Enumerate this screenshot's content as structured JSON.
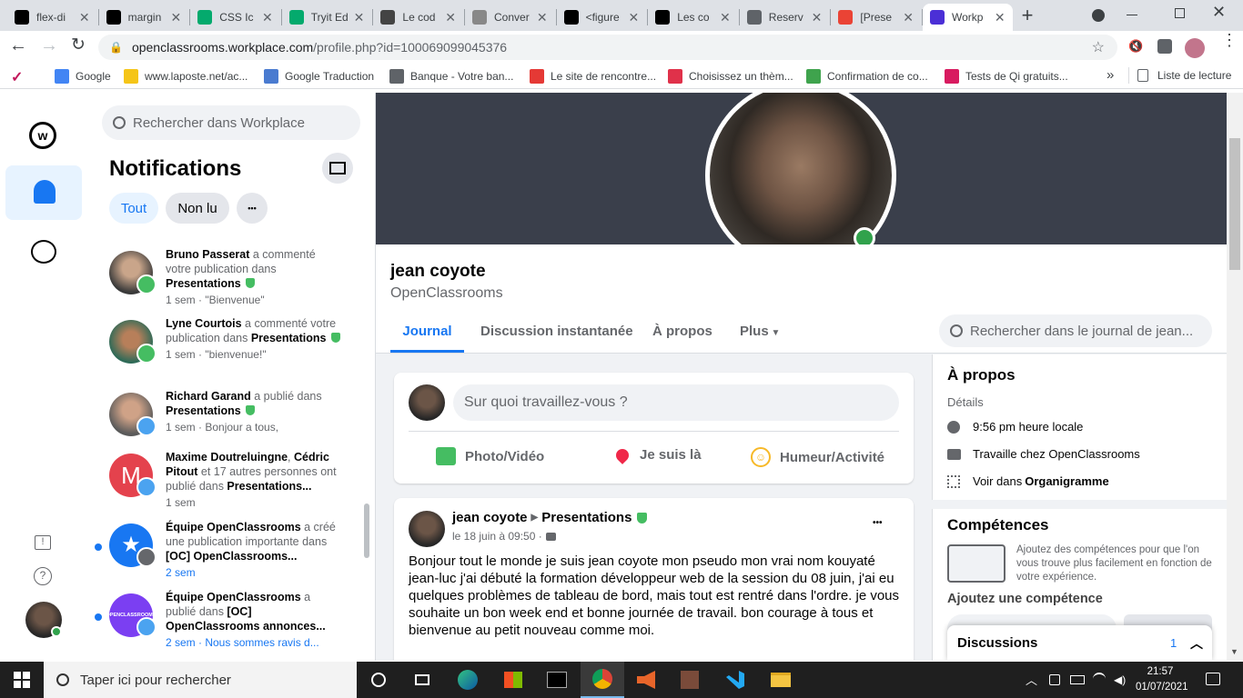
{
  "tabs": [
    {
      "title": "flex-di",
      "icon": "openclassrooms-favicon-icon",
      "color": "#000000"
    },
    {
      "title": "margin",
      "icon": "openclassrooms-favicon-icon",
      "color": "#000000"
    },
    {
      "title": "CSS Ic",
      "icon": "w3schools-favicon-icon",
      "color": "#04aa6d"
    },
    {
      "title": "Tryit Ed",
      "icon": "w3schools-favicon-icon",
      "color": "#04aa6d"
    },
    {
      "title": "Le cod",
      "icon": "spider-favicon-icon",
      "color": "#444444"
    },
    {
      "title": "Conver",
      "icon": "converter-favicon-icon",
      "color": "#888888"
    },
    {
      "title": "<figure",
      "icon": "openclassrooms-favicon-icon",
      "color": "#000000"
    },
    {
      "title": "Les co",
      "icon": "openclassrooms-favicon-icon",
      "color": "#000000"
    },
    {
      "title": "Reserv",
      "icon": "globe-favicon-icon",
      "color": "#5f6368"
    },
    {
      "title": "[Prese",
      "icon": "gmail-favicon-icon",
      "color": "#ea4335"
    },
    {
      "title": "Workp",
      "icon": "workplace-favicon-icon",
      "color": "#4b2fd6"
    }
  ],
  "url": {
    "domain": "openclassrooms.workplace.com",
    "path": "/profile.php?id=100069099045376"
  },
  "bookmarks": [
    {
      "label": "Google",
      "icon": "google-icon"
    },
    {
      "label": "www.laposte.net/ac...",
      "icon": "laposte-icon"
    },
    {
      "label": "Google Traduction",
      "icon": "translate-icon"
    },
    {
      "label": "Banque - Votre ban...",
      "icon": "globe-icon"
    },
    {
      "label": "Le site de rencontre...",
      "icon": "heart-icon"
    },
    {
      "label": "Choisissez un thèm...",
      "icon": "theme-icon"
    },
    {
      "label": "Confirmation de co...",
      "icon": "flower-icon"
    },
    {
      "label": "Tests de Qi gratuits...",
      "icon": "head-icon"
    }
  ],
  "bookmarks_more": "»",
  "reading_list": "Liste de lecture",
  "sidebar": {
    "search_placeholder": "Rechercher dans Workplace"
  },
  "notifications": {
    "title": "Notifications",
    "filters": [
      "Tout",
      "Non lu"
    ],
    "more": "•••",
    "items": [
      {
        "actor": "Bruno Passerat",
        "text": " a commenté votre publication dans ",
        "group": "Presentations",
        "meta": "1 sem · \"Bienvenue\"",
        "badge": "comment",
        "unread": false
      },
      {
        "actor": "Lyne Courtois",
        "text": " a commenté votre publication dans ",
        "group": "Presentations",
        "meta": "1 sem · \"bienvenue!\"",
        "badge": "comment",
        "unread": false
      },
      {
        "actor": "Richard Garand",
        "text": " a publié dans ",
        "group": "Presentations",
        "meta": "1 sem · Bonjour a tous,",
        "badge": "post",
        "unread": false
      },
      {
        "actor": "Maxime Doutreluingne",
        "actor2": "Cédric Pitout",
        "text": " et 17 autres personnes ont publié dans ",
        "group": "Presentations...",
        "meta": "1 sem",
        "badge": "post",
        "unread": false,
        "initial": "M"
      },
      {
        "actor": "Équipe OpenClassrooms",
        "text": " a créé une publication importante dans ",
        "group": "[OC] OpenClassrooms...",
        "meta": "2 sem",
        "badge": "announce",
        "unread": true
      },
      {
        "actor": "Équipe OpenClassrooms",
        "text": " a publié dans ",
        "group": "[OC] OpenClassrooms annonces...",
        "meta": "2 sem · Nous sommes ravis d...",
        "badge": "post",
        "unread": true,
        "logo": "OPENCLASSROOMS"
      }
    ]
  },
  "profile": {
    "name": "jean coyote",
    "company": "OpenClassrooms",
    "tabs": [
      "Journal",
      "Discussion instantanée",
      "À propos",
      "Plus"
    ],
    "search_placeholder": "Rechercher dans le journal de jean...",
    "composer": {
      "placeholder": "Sur quoi travaillez-vous ?",
      "actions": [
        "Photo/Vidéo",
        "Je suis là",
        "Humeur/Activité"
      ]
    },
    "post": {
      "author": "jean coyote",
      "group": "Presentations",
      "date": "le 18 juin à 09:50 ·",
      "more": "•••",
      "body": "Bonjour tout le monde je suis jean coyote mon pseudo mon vrai nom kouyaté jean-luc j'ai débuté la formation développeur web de la session du 08 juin, j'ai eu quelques problèmes de tableau de bord, mais tout est rentré dans l'ordre. je vous souhaite un bon week end et bonne journée de travail. bon courage à tous et bienvenue au petit nouveau comme moi."
    },
    "about": {
      "title": "À propos",
      "subtitle": "Détails",
      "local_time": "9:56 pm heure locale",
      "work": "Travaille chez OpenClassrooms",
      "org_prefix": "Voir dans ",
      "org_link": "Organigramme"
    },
    "skills": {
      "title": "Compétences",
      "description": "Ajoutez des compétences pour que l'on vous trouve plus facilement en fonction de votre expérience.",
      "add_title": "Ajoutez une compétence"
    }
  },
  "chat": {
    "label": "Discussions",
    "count": "1"
  },
  "taskbar": {
    "search_placeholder": "Taper ici pour rechercher",
    "time": "21:57",
    "date": "01/07/2021"
  },
  "colors": {
    "accent": "#1877f2",
    "tab_strip": "#dee1e6",
    "page_bg": "#f0f2f5",
    "cover": "#3a3f4b",
    "online": "#31a24c",
    "taskbar": "#1f1f1f"
  }
}
